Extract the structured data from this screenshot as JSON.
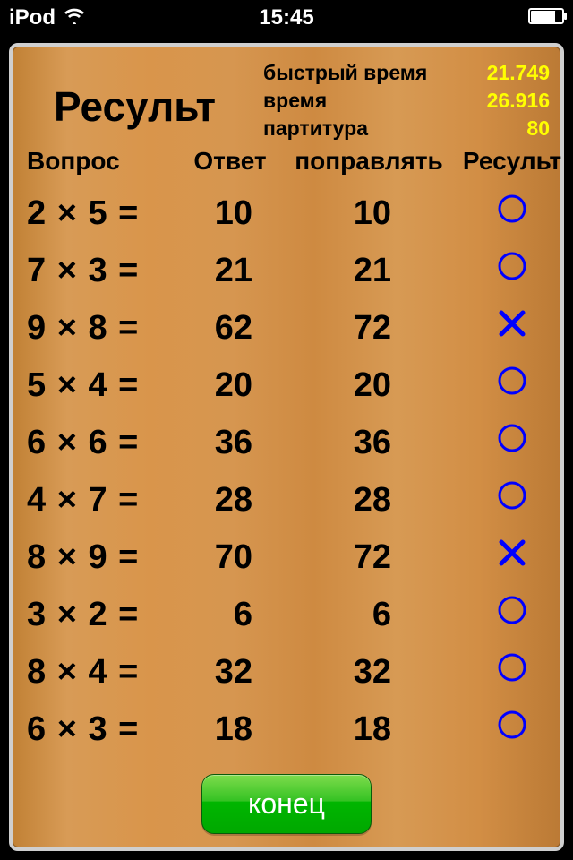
{
  "status": {
    "device": "iPod",
    "time": "15:45"
  },
  "title": "Ресульт",
  "stats": [
    {
      "label": "быстрый время",
      "value": "21.749"
    },
    {
      "label": "время",
      "value": "26.916"
    },
    {
      "label": "партитура",
      "value": "80"
    }
  ],
  "headers": {
    "question": "Вопрос",
    "answer": "Ответ",
    "correct": "поправлять",
    "result": "Ресульт"
  },
  "rows": [
    {
      "question": "2 × 5 =",
      "answer": "10",
      "correct": "10",
      "ok": true
    },
    {
      "question": "7 × 3 =",
      "answer": "21",
      "correct": "21",
      "ok": true
    },
    {
      "question": "9 × 8 =",
      "answer": "62",
      "correct": "72",
      "ok": false
    },
    {
      "question": "5 × 4 =",
      "answer": "20",
      "correct": "20",
      "ok": true
    },
    {
      "question": "6 × 6 =",
      "answer": "36",
      "correct": "36",
      "ok": true
    },
    {
      "question": "4 × 7 =",
      "answer": "28",
      "correct": "28",
      "ok": true
    },
    {
      "question": "8 × 9 =",
      "answer": "70",
      "correct": "72",
      "ok": false
    },
    {
      "question": "3 × 2 =",
      "answer": "6",
      "correct": "6",
      "ok": true
    },
    {
      "question": "8 × 4 =",
      "answer": "32",
      "correct": "32",
      "ok": true
    },
    {
      "question": "6 × 3 =",
      "answer": "18",
      "correct": "18",
      "ok": true
    }
  ],
  "button": "конец"
}
